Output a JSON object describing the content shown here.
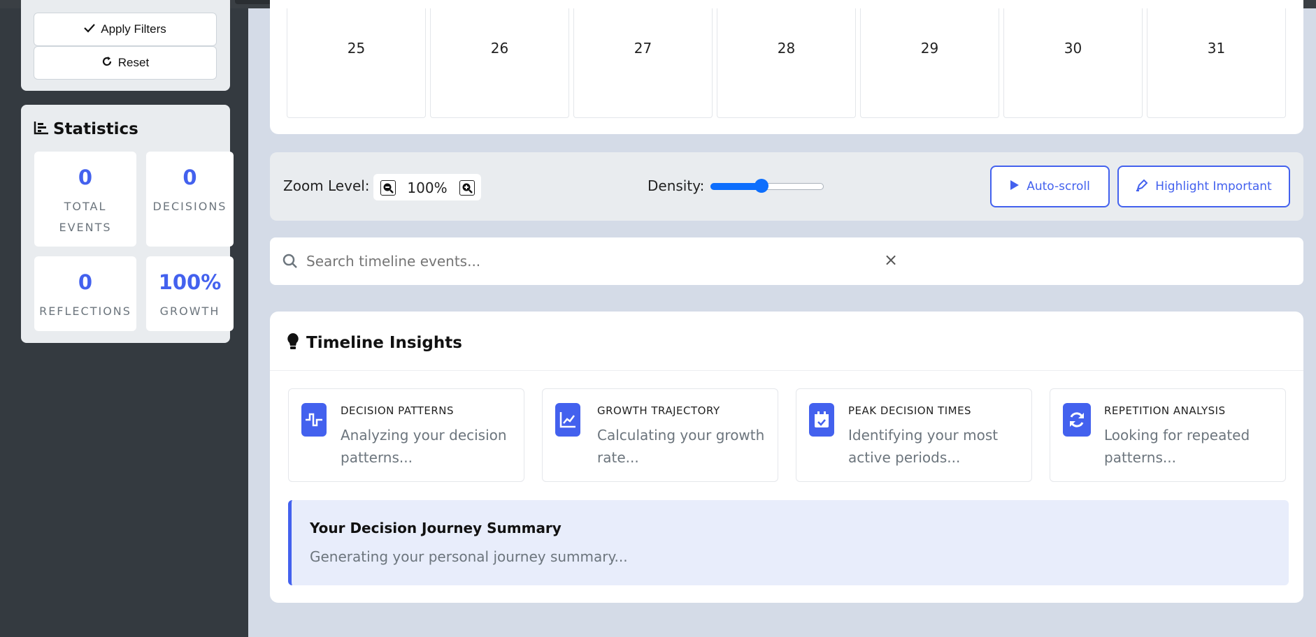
{
  "sidebar": {
    "filters": {
      "apply_label": "Apply Filters",
      "reset_label": "Reset"
    },
    "statistics": {
      "title": "Statistics",
      "items": [
        {
          "value": "0",
          "label": "TOTAL EVENTS"
        },
        {
          "value": "0",
          "label": "DECISIONS"
        },
        {
          "value": "0",
          "label": "REFLECTIONS"
        },
        {
          "value": "100%",
          "label": "GROWTH"
        }
      ]
    }
  },
  "calendar": {
    "days": [
      "25",
      "26",
      "27",
      "28",
      "29",
      "30",
      "31"
    ]
  },
  "controls": {
    "zoom_label": "Zoom Level:",
    "zoom_value": "100%",
    "density_label": "Density:",
    "density_value": 0.45,
    "autoscroll_label": "Auto-scroll",
    "highlight_label": "Highlight Important"
  },
  "search": {
    "placeholder": "Search timeline events...",
    "clear": "×"
  },
  "insights": {
    "title": "Timeline Insights",
    "cards": [
      {
        "title": "DECISION PATTERNS",
        "text": "Analyzing your decision patterns...",
        "icon": "pulse-icon"
      },
      {
        "title": "GROWTH TRAJECTORY",
        "text": "Calculating your growth rate...",
        "icon": "line-chart-icon"
      },
      {
        "title": "PEAK DECISION TIMES",
        "text": "Identifying your most active periods...",
        "icon": "calendar-check-icon"
      },
      {
        "title": "REPETITION ANALYSIS",
        "text": "Looking for repeated patterns...",
        "icon": "refresh-icon"
      }
    ],
    "summary": {
      "title": "Your Decision Journey Summary",
      "text": "Generating your personal journey summary..."
    }
  },
  "colors": {
    "accent": "#4361ee",
    "sidebar": "#343a40",
    "background": "#d4dbe7"
  }
}
